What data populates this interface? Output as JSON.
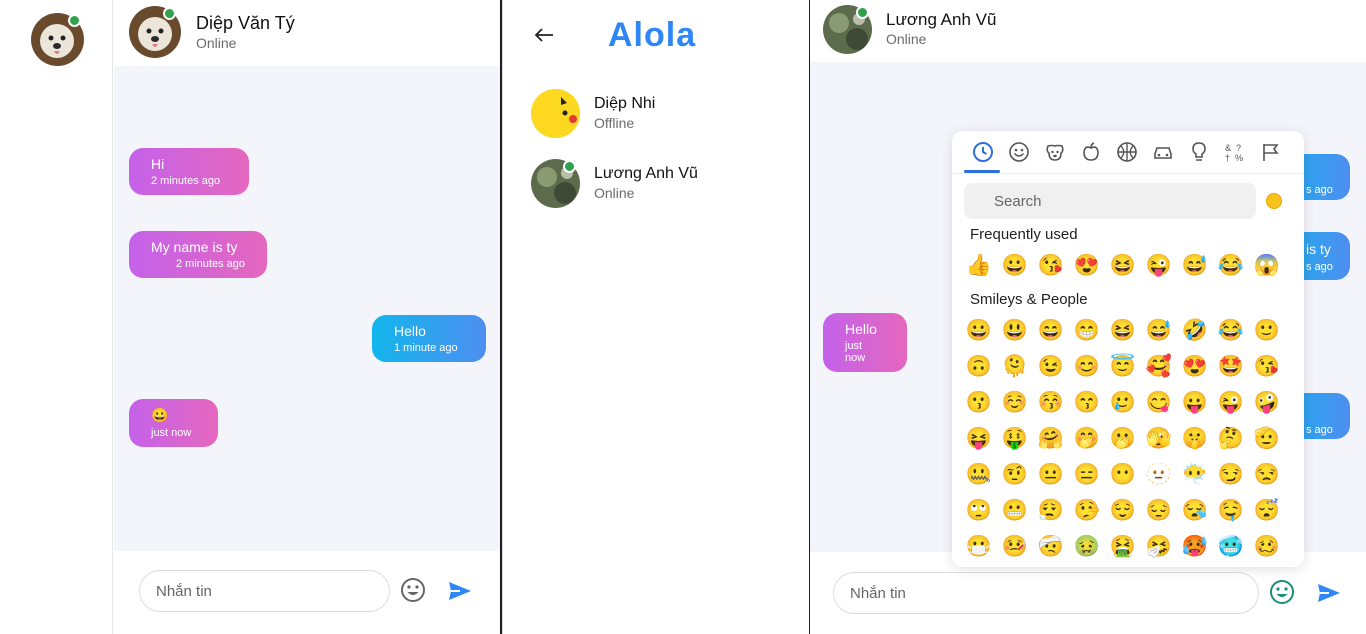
{
  "left_chat": {
    "contact_name": "Diệp Văn Tý",
    "contact_status": "Online",
    "messages": [
      {
        "text": "Hi",
        "time": "2 minutes ago",
        "dir": "in"
      },
      {
        "text": "My name is ty",
        "time": "2 minutes ago",
        "dir": "in"
      },
      {
        "text": "Hello",
        "time": "1 minute ago",
        "dir": "out"
      },
      {
        "text": "😀",
        "time": "just now",
        "dir": "in"
      }
    ],
    "input_placeholder": "Nhắn tin"
  },
  "contacts_panel": {
    "brand": "Alola",
    "back_icon": "back-arrow-icon",
    "contacts": [
      {
        "name": "Diệp Nhi",
        "status": "Offline"
      },
      {
        "name": "Lương Anh Vũ",
        "status": "Online"
      }
    ]
  },
  "right_chat": {
    "contact_name": "Lương Anh Vũ",
    "contact_status": "Online",
    "visible_messages": [
      {
        "text": "s ago",
        "dir": "out"
      },
      {
        "text": "is ty",
        "time": "s ago",
        "dir": "out"
      },
      {
        "text": "Hello",
        "time": "just now",
        "dir": "in"
      },
      {
        "text": "s ago",
        "dir": "out"
      }
    ],
    "input_placeholder": "Nhắn tin"
  },
  "emoji_picker": {
    "categories": [
      "recent-icon",
      "smiley-icon",
      "animal-icon",
      "food-icon",
      "activity-icon",
      "travel-icon",
      "objects-icon",
      "symbols-icon",
      "flags-icon"
    ],
    "search_placeholder": "Search",
    "frequently_used_title": "Frequently used",
    "smileys_title": "Smileys & People",
    "frequently_used": [
      "👍",
      "😀",
      "😘",
      "😍",
      "😆",
      "😜",
      "😅",
      "😂",
      "😱"
    ],
    "smileys": [
      [
        "😀",
        "😃",
        "😄",
        "😁",
        "😆",
        "😅",
        "🤣",
        "😂",
        "🙂"
      ],
      [
        "🙃",
        "🫠",
        "😉",
        "😊",
        "😇",
        "🥰",
        "😍",
        "🤩",
        "😘"
      ],
      [
        "😗",
        "☺️",
        "😚",
        "😙",
        "🥲",
        "😋",
        "😛",
        "😜",
        "🤪"
      ],
      [
        "😝",
        "🤑",
        "🤗",
        "🤭",
        "🫢",
        "🫣",
        "🤫",
        "🤔",
        "🫡"
      ],
      [
        "🤐",
        "🤨",
        "😐",
        "😑",
        "😶",
        "🫥",
        "😶‍🌫️",
        "😏",
        "😒"
      ],
      [
        "🙄",
        "😬",
        "😮‍💨",
        "🤥",
        "😌",
        "😔",
        "😪",
        "🤤",
        "😴"
      ],
      [
        "😷",
        "🤒",
        "🤕",
        "🤢",
        "🤮",
        "🤧",
        "🥵",
        "🥶",
        "🥴"
      ]
    ]
  },
  "colors": {
    "incoming_gradient": [
      "#c462ea",
      "#e567be"
    ],
    "outgoing_gradient": [
      "#12b6ec",
      "#4d8ef0"
    ],
    "brand": "#2f86f6",
    "online": "#31a24c",
    "chat_bg": "#f4f5fa"
  }
}
